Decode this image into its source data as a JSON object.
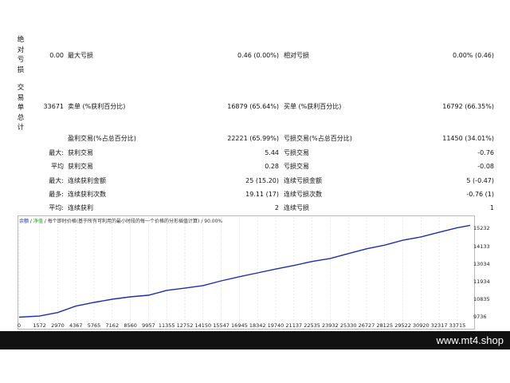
{
  "side_labels": {
    "absolute_drawdown": [
      "绝",
      "对",
      "亏",
      "损"
    ],
    "total_trades": [
      "交",
      "易",
      "单",
      "总",
      "计"
    ]
  },
  "stats": {
    "row1": {
      "value": "0.00",
      "max_dd_label": "最大亏损",
      "max_dd_value": "0.46 (0.00%)",
      "rel_dd_label": "相对亏损",
      "rel_dd_value": "0.00% (0.46)"
    },
    "row2": {
      "value": "33671",
      "short_label": "卖单 (%获利百分比)",
      "short_value": "16879 (65.64%)",
      "long_label": "买单 (%获利百分比)",
      "long_value": "16792 (66.35%)"
    },
    "row3": {
      "profit_label": "盈利交易(%占总百分比)",
      "profit_value": "22221 (65.99%)",
      "loss_label": "亏损交易(%占总百分比)",
      "loss_value": "11450 (34.01%)"
    },
    "row4": {
      "prefix": "最大:",
      "label": "获利交易",
      "value": "5.44",
      "label2": "亏损交易",
      "value2": "-0.76"
    },
    "row5": {
      "prefix": "平均",
      "label": "获利交易",
      "value": "0.28",
      "label2": "亏损交易",
      "value2": "-0.08"
    },
    "row6": {
      "prefix": "最大:",
      "label": "连续获利金额",
      "value": "25 (15.20)",
      "label2": "连续亏损金额",
      "value2": "5 (-0.47)"
    },
    "row7": {
      "prefix": "最多:",
      "label": "连续获利次数",
      "value": "19.11 (17)",
      "label2": "连续亏损次数",
      "value2": "-0.76 (1)"
    },
    "row8": {
      "prefix": "平均:",
      "label": "连续获利",
      "value": "2",
      "label2": "连续亏损",
      "value2": "1"
    }
  },
  "chart_legend": {
    "balance": "余额",
    "sep1": " / ",
    "equity": "净值",
    "sep2": " / ",
    "desc": "每个即时价格(基于所有可利用的最小时段的每一个价格的分形插值计算)",
    "sep3": " / ",
    "quality": "90.00%"
  },
  "chart_data": {
    "type": "line",
    "xticks": [
      "0",
      "1572",
      "2970",
      "4367",
      "5765",
      "7162",
      "8560",
      "9957",
      "11355",
      "12752",
      "14150",
      "15547",
      "16945",
      "18342",
      "19740",
      "21137",
      "22535",
      "23932",
      "25330",
      "26727",
      "28125",
      "29522",
      "30920",
      "32317",
      "33715"
    ],
    "yticks": [
      "15232",
      "14133",
      "13034",
      "11934",
      "10835",
      "9736"
    ],
    "series": [
      {
        "color": "#1d2fb0",
        "x": [
          0,
          1572,
          2970,
          4367,
          5765,
          7162,
          8560,
          9957,
          11355,
          12752,
          14150,
          15547,
          16945,
          18342,
          19740,
          21137,
          22535,
          23932,
          25330,
          26727,
          28125,
          29522,
          30920,
          32317,
          33715,
          34700
        ],
        "y": [
          9760,
          9830,
          10050,
          10450,
          10680,
          10880,
          11030,
          11130,
          11430,
          11570,
          11730,
          12020,
          12280,
          12520,
          12760,
          12980,
          13230,
          13420,
          13720,
          14020,
          14250,
          14550,
          14760,
          15050,
          15330,
          15480
        ]
      }
    ],
    "xlim": [
      0,
      34700
    ],
    "ylim": [
      9736,
      15700
    ]
  },
  "footer": {
    "site": "www.mt4.shop"
  },
  "colors": {
    "line": "#1d2fb0",
    "footer_bg": "#111111"
  }
}
